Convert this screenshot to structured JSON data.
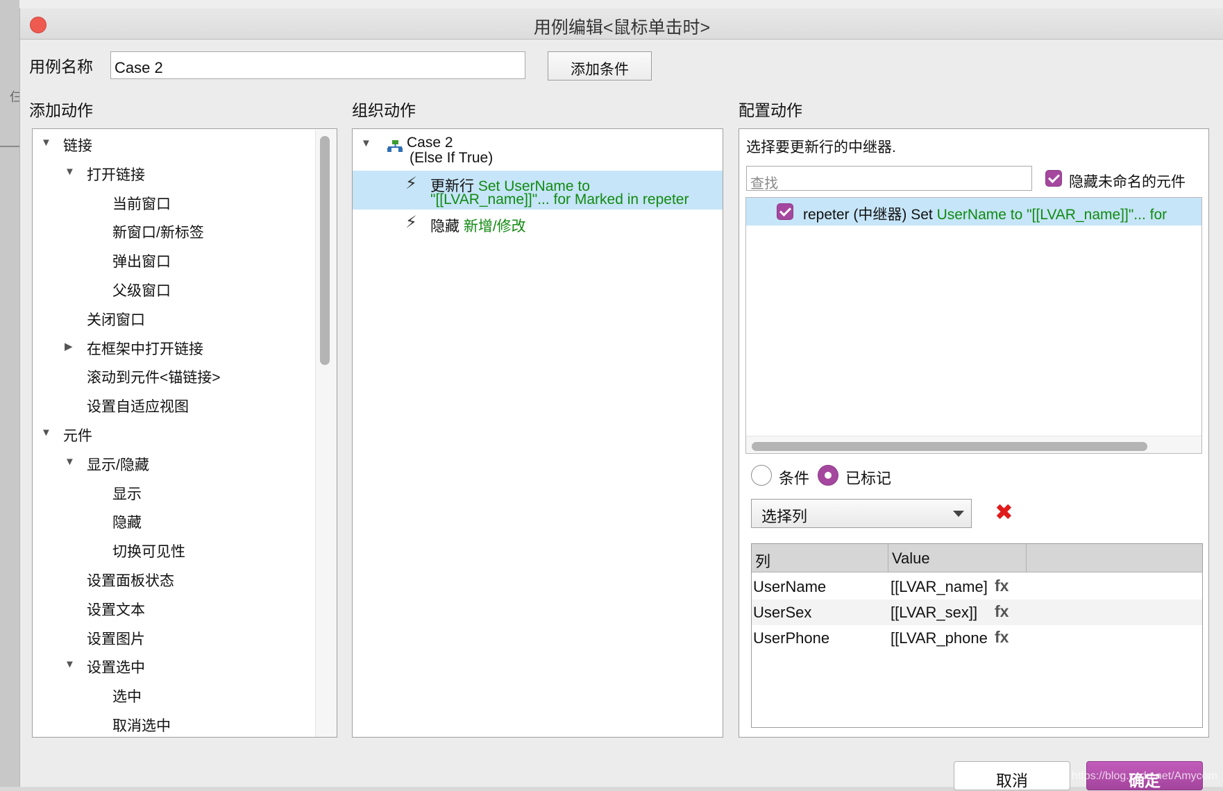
{
  "background": {
    "side_char": "仨"
  },
  "window": {
    "title": "用例编辑<鼠标单击时>"
  },
  "case_name": {
    "label": "用例名称",
    "value": "Case 2"
  },
  "add_condition_label": "添加条件",
  "sections": {
    "add": "添加动作",
    "organize": "组织动作",
    "configure": "配置动作"
  },
  "add_tree": [
    {
      "label": "链接",
      "level": 0,
      "expander": "down"
    },
    {
      "label": "打开链接",
      "level": 1,
      "expander": "down"
    },
    {
      "label": "当前窗口",
      "level": 2,
      "expander": ""
    },
    {
      "label": "新窗口/新标签",
      "level": 2,
      "expander": ""
    },
    {
      "label": "弹出窗口",
      "level": 2,
      "expander": ""
    },
    {
      "label": "父级窗口",
      "level": 2,
      "expander": ""
    },
    {
      "label": "关闭窗口",
      "level": 1,
      "expander": ""
    },
    {
      "label": "在框架中打开链接",
      "level": 1,
      "expander": "right"
    },
    {
      "label": "滚动到元件<锚链接>",
      "level": 1,
      "expander": ""
    },
    {
      "label": "设置自适应视图",
      "level": 1,
      "expander": ""
    },
    {
      "label": "元件",
      "level": 0,
      "expander": "down"
    },
    {
      "label": "显示/隐藏",
      "level": 1,
      "expander": "down"
    },
    {
      "label": "显示",
      "level": 2,
      "expander": ""
    },
    {
      "label": "隐藏",
      "level": 2,
      "expander": ""
    },
    {
      "label": "切换可见性",
      "level": 2,
      "expander": ""
    },
    {
      "label": "设置面板状态",
      "level": 1,
      "expander": ""
    },
    {
      "label": "设置文本",
      "level": 1,
      "expander": ""
    },
    {
      "label": "设置图片",
      "level": 1,
      "expander": ""
    },
    {
      "label": "设置选中",
      "level": 1,
      "expander": "down"
    },
    {
      "label": "选中",
      "level": 2,
      "expander": ""
    },
    {
      "label": "取消选中",
      "level": 2,
      "expander": ""
    }
  ],
  "organize": {
    "case_title": "Case 2",
    "case_condition": "(Else If True)",
    "actions": [
      {
        "verb": "更新行",
        "line1": "Set UserName to",
        "line2": "\"[[LVAR_name]]\"... for Marked in repeter",
        "selected": true
      },
      {
        "verb": "隐藏",
        "line1": "新增/修改",
        "line2": "",
        "selected": false
      }
    ]
  },
  "configure": {
    "instruction": "选择要更新行的中继器.",
    "search_placeholder": "查找",
    "hide_unnamed_label": "隐藏未命名的元件",
    "hide_unnamed_checked": true,
    "repeater_row": {
      "checked": true,
      "prefix": "repeter (中继器) Set",
      "detail": "UserName to \"[[LVAR_name]]\"... for"
    },
    "radio": {
      "condition": "条件",
      "marked": "已标记",
      "selected": "marked"
    },
    "select_column": "选择列",
    "table": {
      "headers": [
        "列",
        "Value"
      ],
      "rows": [
        {
          "column": "UserName",
          "value": "[[LVAR_name]",
          "fx": "fx"
        },
        {
          "column": "UserSex",
          "value": "[[LVAR_sex]]",
          "fx": "fx"
        },
        {
          "column": "UserPhone",
          "value": "[[LVAR_phone",
          "fx": "fx"
        }
      ]
    }
  },
  "buttons": {
    "cancel": "取消",
    "ok": "确定"
  },
  "watermark": "https://blog.csdn.net/Amycom",
  "colors": {
    "accent": "#a5479e",
    "selection": "#c6e5f8",
    "green_text": "#118a11",
    "delete": "#e01b1b"
  }
}
